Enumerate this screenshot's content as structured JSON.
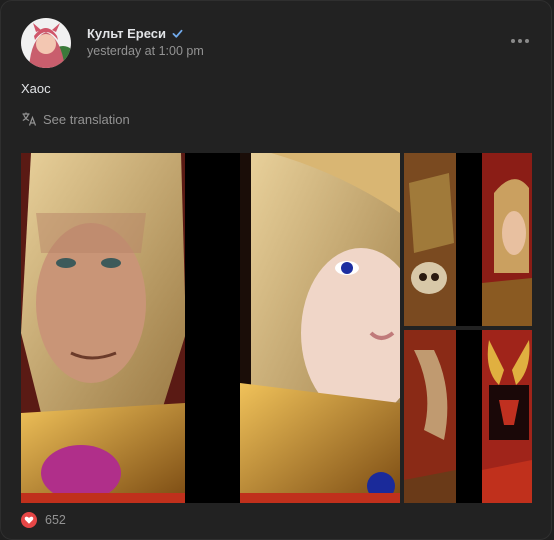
{
  "post": {
    "author": "Культ Ереси",
    "time": "yesterday at 1:00 pm",
    "text": "Хаос",
    "translate_label": "See translation",
    "likes": "652"
  },
  "icons": {
    "verified": "verified-check-icon",
    "more": "more-horizontal-icon",
    "translate": "translate-icon",
    "like": "heart-icon"
  },
  "colors": {
    "accent": "#71aaeb",
    "like": "#e64646",
    "background": "#222222"
  }
}
